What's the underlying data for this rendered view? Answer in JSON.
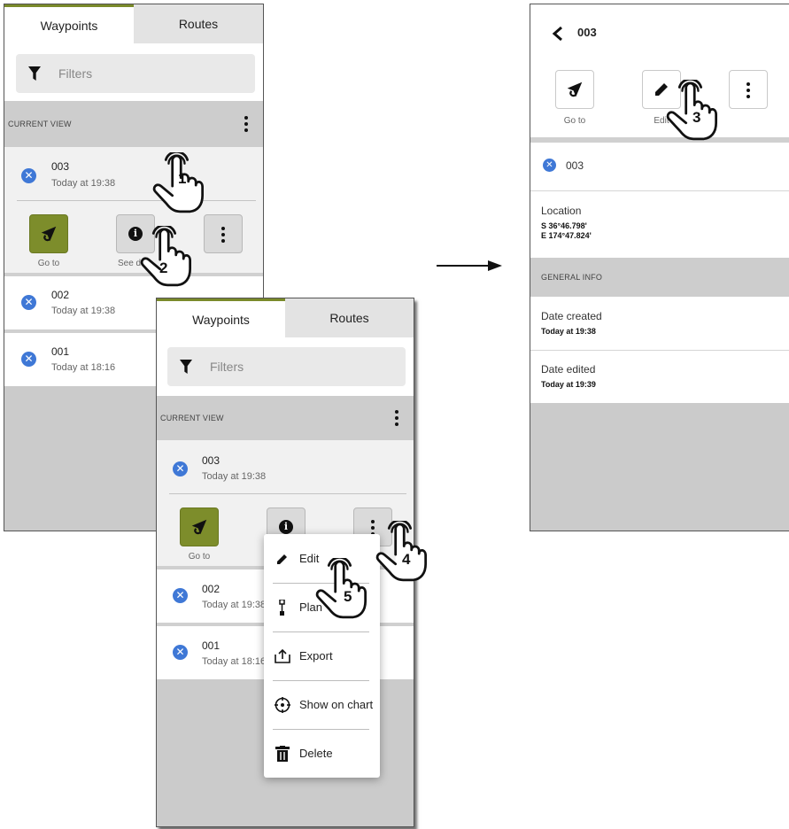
{
  "left_panel": {
    "tabs": [
      "Waypoints",
      "Routes"
    ],
    "filters_label": "Filters",
    "section_label": "CURRENT VIEW",
    "waypoints": [
      {
        "name": "003",
        "time": "Today at 19:38"
      },
      {
        "name": "002",
        "time": "Today at 19:38"
      },
      {
        "name": "001",
        "time": "Today at 18:16"
      }
    ],
    "goto_label": "Go to",
    "details_label": "See deta"
  },
  "middle_panel": {
    "tabs": [
      "Waypoints",
      "Routes"
    ],
    "filters_label": "Filters",
    "section_label": "CURRENT VIEW",
    "waypoints": [
      {
        "name": "003",
        "time": "Today at 19:38"
      },
      {
        "name": "002",
        "time": "Today at 19:38"
      },
      {
        "name": "001",
        "time": "Today at 18:16"
      }
    ],
    "goto_label": "Go to",
    "menu": [
      "Edit",
      "Plan",
      "Export",
      "Show on chart",
      "Delete"
    ]
  },
  "right_panel": {
    "title": "003",
    "goto_label": "Go to",
    "edit_label": "Edit",
    "waypoint_name": "003",
    "location_label": "Location",
    "location_lat": "S 36°46.798'",
    "location_lon": "E 174°47.824'",
    "general_info_label": "GENERAL INFO",
    "date_created_label": "Date created",
    "date_created_value": "Today at 19:38",
    "date_edited_label": "Date edited",
    "date_edited_value": "Today at 19:39"
  },
  "steps": [
    "1",
    "2",
    "3",
    "4",
    "5"
  ],
  "icons": {
    "filter": "funnel-icon",
    "goto": "navigation-arrow-icon",
    "info": "info-icon",
    "more": "kebab-menu-icon",
    "remove": "close-circle-icon",
    "back": "chevron-left-icon",
    "edit": "pencil-icon",
    "plan": "route-plan-icon",
    "export": "export-icon",
    "chart": "crosshair-icon",
    "delete": "trash-icon",
    "gesture": "tap-hand-icon"
  },
  "colors": {
    "tab_accent": "#7a8a2a",
    "goto_button": "#7d8d2b",
    "remove_icon": "#3f78d6",
    "section_bg": "#cdcdcd"
  }
}
